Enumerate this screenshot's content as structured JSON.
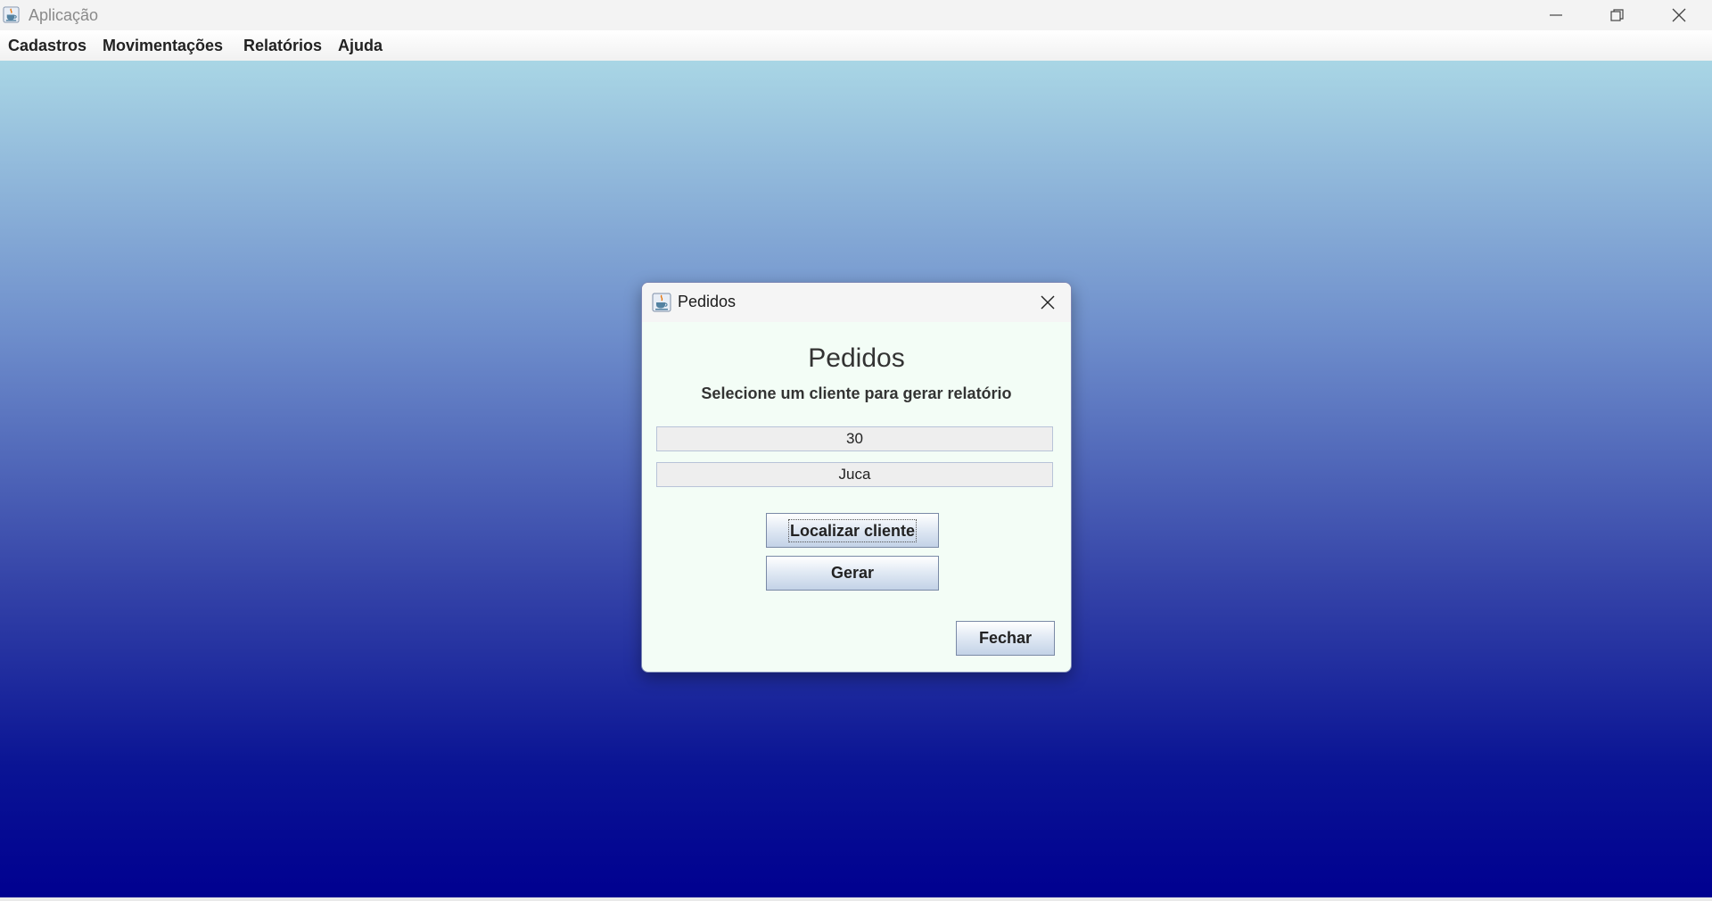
{
  "window": {
    "title": "Aplicação",
    "app_icon": "java-cup-icon",
    "controls": [
      "minimize-icon",
      "maximize-icon",
      "close-icon"
    ]
  },
  "menubar": {
    "items": [
      {
        "label": "Cadastros"
      },
      {
        "label": "Movimentações"
      },
      {
        "label": "Relatórios"
      },
      {
        "label": "Ajuda"
      }
    ]
  },
  "dialog": {
    "title": "Pedidos",
    "icon": "java-cup-icon",
    "heading": "Pedidos",
    "subheading": "Selecione um cliente para gerar relatório",
    "client_code": "30",
    "client_name": "Juca",
    "buttons": {
      "locate": "Localizar cliente",
      "generate": "Gerar",
      "close": "Fechar"
    }
  },
  "colors": {
    "desktop_gradient_top": "#a9d6e5",
    "desktop_gradient_bottom": "#000090",
    "dialog_background": "#f3fdf6"
  }
}
